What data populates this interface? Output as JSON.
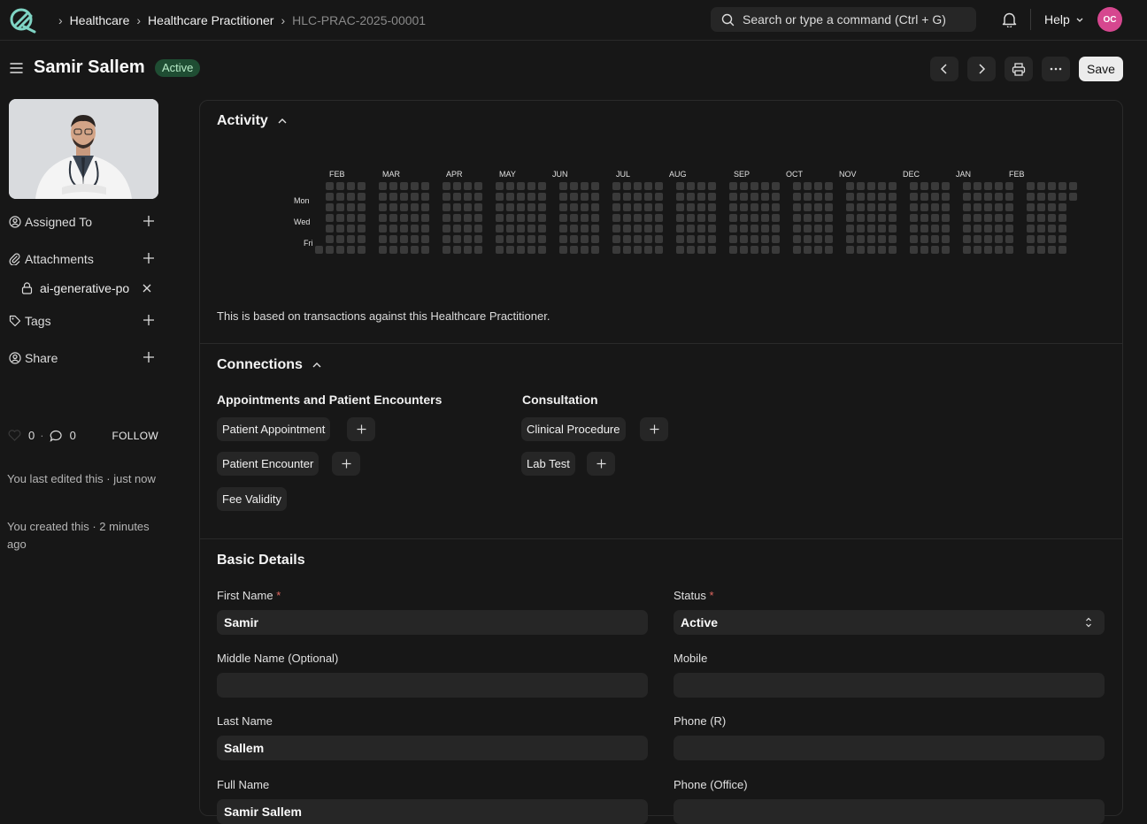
{
  "nav": {
    "breadcrumbs": [
      "Healthcare",
      "Healthcare Practitioner",
      "HLC-PRAC-2025-00001"
    ],
    "search_placeholder": "Search or type a command (Ctrl + G)",
    "help_label": "Help",
    "user_initials": "OC"
  },
  "header": {
    "title": "Samir Sallem",
    "status": "Active",
    "save_label": "Save"
  },
  "sidebar": {
    "assigned_to": "Assigned To",
    "attachments": "Attachments",
    "attachment_file": "ai-generative-po",
    "tags": "Tags",
    "share": "Share",
    "likes": "0",
    "comments": "0",
    "follow": "FOLLOW",
    "edited_note": "You last edited this · just now",
    "created_note": "You created this · 2 minutes ago"
  },
  "activity": {
    "title": "Activity",
    "months": [
      "FEB",
      "MAR",
      "APR",
      "MAY",
      "JUN",
      "JUL",
      "AUG",
      "SEP",
      "OCT",
      "NOV",
      "DEC",
      "JAN",
      "FEB"
    ],
    "day_labels": [
      "Mon",
      "Wed",
      "Fri"
    ],
    "note": "This is based on transactions against this Healthcare Practitioner."
  },
  "connections": {
    "title": "Connections",
    "groups": [
      {
        "heading": "Appointments and Patient Encounters",
        "items": [
          "Patient Appointment",
          "Patient Encounter",
          "Fee Validity"
        ]
      },
      {
        "heading": "Consultation",
        "items": [
          "Clinical Procedure",
          "Lab Test"
        ]
      }
    ]
  },
  "basic_details": {
    "title": "Basic Details",
    "first_name_label": "First Name",
    "first_name": "Samir",
    "status_label": "Status",
    "status": "Active",
    "middle_name_label": "Middle Name (Optional)",
    "middle_name": "",
    "mobile_label": "Mobile",
    "mobile": "",
    "last_name_label": "Last Name",
    "last_name": "Sallem",
    "phone_r_label": "Phone (R)",
    "phone_r": "",
    "full_name_label": "Full Name",
    "full_name": "Samir Sallem",
    "phone_office_label": "Phone (Office)",
    "phone_office": "",
    "required_mark": "*"
  },
  "colors": {
    "background": "#171717",
    "surface": "#262626",
    "badge_green": "#1f4d33",
    "avatar_pink": "#d6478f",
    "heat_cell": "#3a3a3a"
  }
}
